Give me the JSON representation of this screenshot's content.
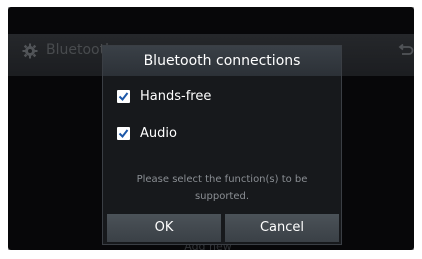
{
  "background": {
    "title": "Bluetooth",
    "settings_icon": "gear-icon",
    "back_icon": "back-arrow-icon",
    "bottom_button": "Add new"
  },
  "dialog": {
    "title": "Bluetooth connections",
    "options": [
      {
        "label": "Hands-free",
        "checked": true
      },
      {
        "label": "Audio",
        "checked": true
      }
    ],
    "info_line1": "Please select the function(s) to be",
    "info_line2": "supported.",
    "ok_label": "OK",
    "cancel_label": "Cancel"
  },
  "colors": {
    "dialog_bg": "#17191c",
    "button_bg": "#444a50",
    "text": "#ffffff",
    "info_text": "#8a8e93"
  }
}
